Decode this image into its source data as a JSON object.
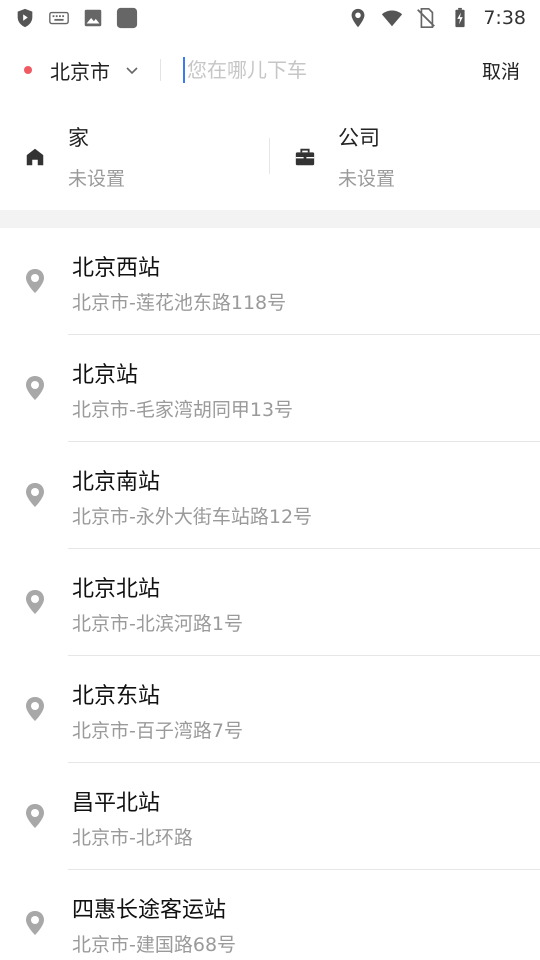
{
  "status_bar": {
    "time": "7:38",
    "left_icons": [
      "shield-icon",
      "keyboard-icon",
      "image-icon",
      "app-square-icon"
    ],
    "right_icons": [
      "location-icon",
      "wifi-icon",
      "no-sim-icon",
      "battery-charging-icon"
    ]
  },
  "search": {
    "city": "北京市",
    "placeholder": "您在哪儿下车",
    "value": "",
    "cancel_label": "取消",
    "accent_color": "#3b7bf0",
    "city_dot_color": "#f05b63"
  },
  "shortcuts": {
    "home": {
      "title": "家",
      "subtitle": "未设置"
    },
    "company": {
      "title": "公司",
      "subtitle": "未设置"
    }
  },
  "results": [
    {
      "name": "北京西站",
      "address": "北京市-莲花池东路118号"
    },
    {
      "name": "北京站",
      "address": "北京市-毛家湾胡同甲13号"
    },
    {
      "name": "北京南站",
      "address": "北京市-永外大街车站路12号"
    },
    {
      "name": "北京北站",
      "address": "北京市-北滨河路1号"
    },
    {
      "name": "北京东站",
      "address": "北京市-百子湾路7号"
    },
    {
      "name": "昌平北站",
      "address": "北京市-北环路"
    },
    {
      "name": "四惠长途客运站",
      "address": "北京市-建国路68号"
    }
  ]
}
